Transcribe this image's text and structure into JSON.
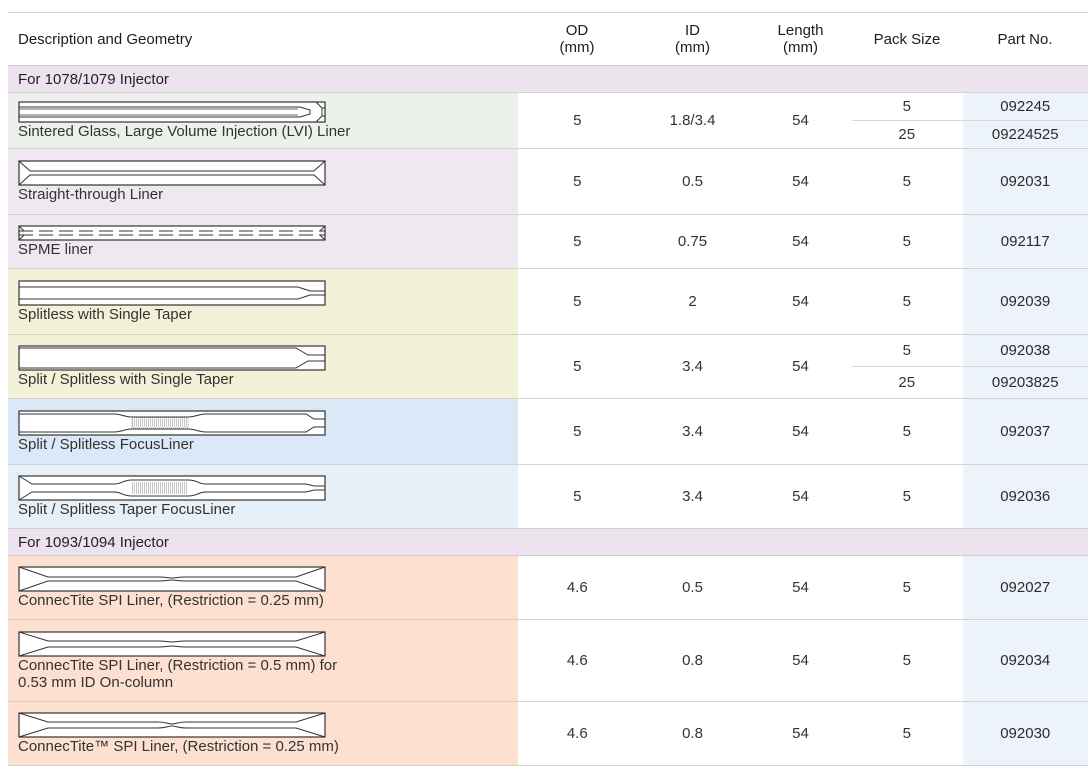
{
  "header": {
    "description": "Description and Geometry",
    "od": "OD",
    "od_unit": "(mm)",
    "id": "ID",
    "id_unit": "(mm)",
    "length": "Length",
    "length_unit": "(mm)",
    "pack_size": "Pack Size",
    "part_no": "Part No."
  },
  "sections": [
    {
      "title": "For 1078/1079 Injector",
      "rows": [
        {
          "description": "Sintered Glass, Large Volume Injection (LVI) Liner",
          "icon": "sintered-glass-liner-icon",
          "od": "5",
          "id": "1.8/3.4",
          "length": "54",
          "packs": [
            {
              "size": "5",
              "part": "092245"
            },
            {
              "size": "25",
              "part": "09224525"
            }
          ]
        },
        {
          "description": "Straight-through Liner",
          "icon": "straight-through-liner-icon",
          "od": "5",
          "id": "0.5",
          "length": "54",
          "packs": [
            {
              "size": "5",
              "part": "092031"
            }
          ]
        },
        {
          "description": "SPME liner",
          "icon": "spme-liner-icon",
          "od": "5",
          "id": "0.75",
          "length": "54",
          "packs": [
            {
              "size": "5",
              "part": "092117"
            }
          ]
        },
        {
          "description": "Splitless with Single Taper",
          "icon": "splitless-single-taper-liner-icon",
          "od": "5",
          "id": "2",
          "length": "54",
          "packs": [
            {
              "size": "5",
              "part": "092039"
            }
          ]
        },
        {
          "description": "Split / Splitless with Single Taper",
          "icon": "split-splitless-single-taper-liner-icon",
          "od": "5",
          "id": "3.4",
          "length": "54",
          "packs": [
            {
              "size": "5",
              "part": "092038"
            },
            {
              "size": "25",
              "part": "09203825"
            }
          ]
        },
        {
          "description": "Split / Splitless FocusLiner",
          "icon": "focusliner-icon",
          "od": "5",
          "id": "3.4",
          "length": "54",
          "packs": [
            {
              "size": "5",
              "part": "092037"
            }
          ]
        },
        {
          "description": "Split / Splitless Taper FocusLiner",
          "icon": "taper-focusliner-icon",
          "od": "5",
          "id": "3.4",
          "length": "54",
          "packs": [
            {
              "size": "5",
              "part": "092036"
            }
          ]
        }
      ]
    },
    {
      "title": "For 1093/1094 Injector",
      "rows": [
        {
          "description": "ConnecTite SPI Liner, (Restriction = 0.25 mm)",
          "icon": "connectite-spi-liner-icon",
          "od": "4.6",
          "id": "0.5",
          "length": "54",
          "packs": [
            {
              "size": "5",
              "part": "092027"
            }
          ]
        },
        {
          "description": "ConnecTite SPI Liner, (Restriction = 0.5 mm) for",
          "description2": "0.53 mm ID On-column",
          "icon": "connectite-spi-liner-icon",
          "od": "4.6",
          "id": "0.8",
          "length": "54",
          "packs": [
            {
              "size": "5",
              "part": "092034"
            }
          ]
        },
        {
          "description": "ConnecTite™ SPI Liner, (Restriction = 0.25 mm)",
          "icon": "connectite-spi-liner-icon",
          "od": "4.6",
          "id": "0.8",
          "length": "54",
          "packs": [
            {
              "size": "5",
              "part": "092030"
            }
          ]
        }
      ]
    }
  ],
  "colors": {
    "section_bg": "#ece3ee",
    "part_no_bg": "#edf3fb",
    "green": "#edf1ec",
    "purple": "#efe8f0",
    "yellow": "#f3f1d7",
    "blue": "#dbe8f7",
    "light_blue": "#e6f0f8",
    "orange": "#fde0cf"
  }
}
